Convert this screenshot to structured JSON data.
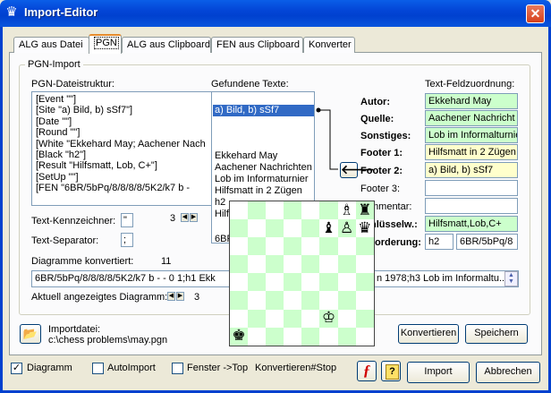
{
  "window": {
    "title": "Import-Editor",
    "app_icon": "♛",
    "close_glyph": "✕"
  },
  "tabs": [
    {
      "label": "ALG aus Datei"
    },
    {
      "label": "PGN"
    },
    {
      "label": "ALG aus Clipboard"
    },
    {
      "label": "FEN aus Clipboard"
    },
    {
      "label": "Konverter"
    }
  ],
  "pgn_import": {
    "group_label": "PGN-Import",
    "structure_label": "PGN-Dateistruktur:",
    "structure_lines": [
      "[Event \"\"]",
      "[Site \"a) Bild, b) sSf7\"]",
      "[Date \"\"]",
      "[Round \"\"]",
      "[White \"Ekkehard May; Aachener Nach",
      "[Black \"h2\"]",
      "[Result \"Hilfsmatt, Lob, C+\"]",
      "[SetUp \"\"]",
      "[FEN \"6BR/5bPq/8/8/8/8/5K2/k7 b -"
    ],
    "found_label": "Gefundene Texte:",
    "found_items": [
      {
        "text": "a) Bild, b) sSf7",
        "selected": true
      },
      {
        "text": "Ekkehard May",
        "selected": false
      },
      {
        "text": "Aachener Nachrichten",
        "selected": false
      },
      {
        "text": "Lob im Informaturnier",
        "selected": false
      },
      {
        "text": "Hilfsmatt in 2 Zügen",
        "selected": false
      },
      {
        "text": "h2",
        "selected": false
      },
      {
        "text": "Hilf",
        "selected": false
      },
      {
        "text": "6BR",
        "selected": false
      }
    ],
    "assign_label": "Text-Feldzuordnung:",
    "assign_arrow": "🡐",
    "fields": [
      {
        "label": "Autor:",
        "value": "Ekkehard May",
        "bg": "#ccffcc",
        "bold": true
      },
      {
        "label": "Quelle:",
        "value": "Aachener Nachricht",
        "bg": "#ccffcc",
        "bold": true
      },
      {
        "label": "Sonstiges:",
        "value": "Lob im Informalturnie",
        "bg": "#ccffcc",
        "bold": true
      },
      {
        "label": "Footer 1:",
        "value": "Hilfsmatt in 2 Zügen",
        "bg": "#ffffcc",
        "bold": true
      },
      {
        "label": "Footer 2:",
        "value": "a) Bild, b) sSf7",
        "bg": "#ffffcc",
        "bold": true
      },
      {
        "label": "Footer 3:",
        "value": "",
        "bg": "#ffffff",
        "bold": false
      },
      {
        "label": "mmentar:",
        "value": "",
        "bg": "#ffffff",
        "bold": false
      },
      {
        "label": "hlüsselw.:",
        "value": "Hilfsmatt,Lob,C+",
        "bg": "#ccffcc",
        "bold": true
      }
    ],
    "forderung_label": "orderung:",
    "forderung_value": "h2",
    "fen_value": "6BR/5bPq/8",
    "kennzeichner_label": "Text-Kennzeichner:",
    "kennzeichner_value": "\"",
    "separator_label": "Text-Separator:",
    "separator_value": ";",
    "counter_value": "3",
    "converted_label": "Diagramme konvertiert:",
    "converted_count": "11",
    "converted_text_left": "6BR/5bPq/8/8/8/8/5K2/k7 b - - 0 1;h1 Ekk",
    "converted_text_right": "n 1978;h3 Lob im Informaltu...",
    "current_label": "Aktuell angezeigtes Diagramm:",
    "current_value": "3"
  },
  "board": {
    "rows": [
      [
        "",
        "",
        "",
        "",
        "",
        "",
        "♗",
        "♜"
      ],
      [
        "",
        "",
        "",
        "",
        "",
        "♝",
        "♙",
        "♛"
      ],
      [
        "",
        "",
        "",
        "",
        "",
        "",
        "",
        ""
      ],
      [
        "",
        "",
        "",
        "",
        "",
        "",
        "",
        ""
      ],
      [
        "",
        "",
        "",
        "",
        "",
        "",
        "",
        ""
      ],
      [
        "",
        "",
        "",
        "",
        "",
        "",
        "",
        ""
      ],
      [
        "",
        "",
        "",
        "",
        "",
        "♔",
        "",
        ""
      ],
      [
        "♚",
        "",
        "",
        "",
        "",
        "",
        "",
        ""
      ]
    ],
    "dark_color": "#ccffcc",
    "light_color": "#ffffff"
  },
  "import_file": {
    "label": "Importdatei:",
    "path": "c:\\chess problems\\may.pgn",
    "folder_icon": "📂"
  },
  "buttons": {
    "convert": "Konvertieren",
    "save": "Speichern",
    "import": "Import",
    "cancel": "Abbrechen"
  },
  "bottom": {
    "diagram_label": "Diagramm",
    "autoimport_label": "AutoImport",
    "window_top_label": "Fenster ->Top",
    "convert_stop_label": "Konvertieren#Stop",
    "flash_icon": "ƒ",
    "help_icon": "?"
  },
  "colors": {
    "accent_green": "#ccffcc",
    "accent_yellow": "#ffffcc",
    "title_blue": "#0041cf"
  }
}
